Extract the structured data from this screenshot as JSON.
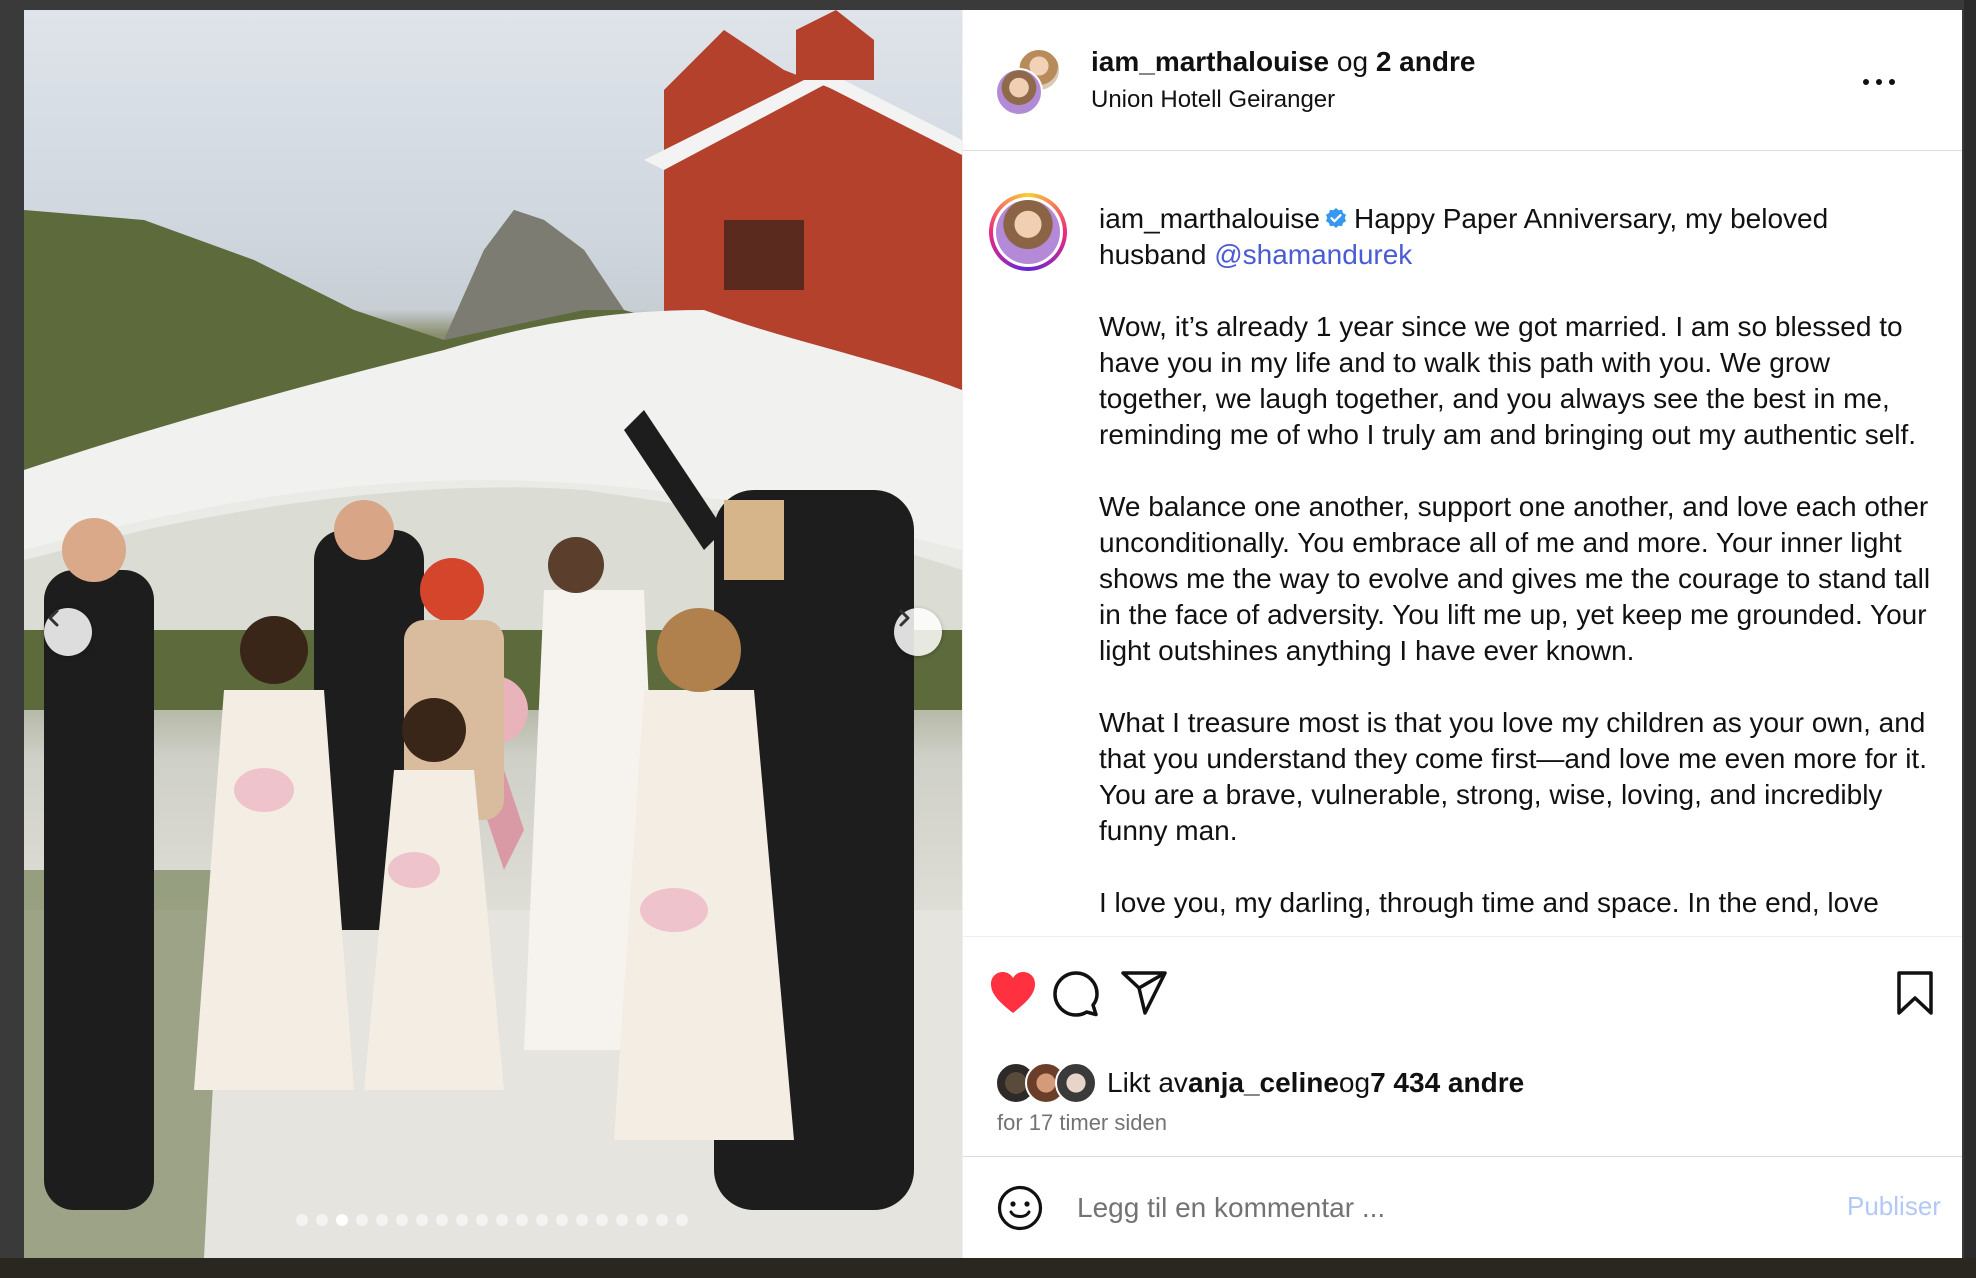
{
  "header": {
    "username": "iam_marthalouise",
    "connector": " og ",
    "others": "2 andre",
    "location": "Union Hotell Geiranger"
  },
  "caption": {
    "username": "iam_marthalouise",
    "first_line": "Happy Paper Anniversary, my beloved husband ",
    "mention": "@shamandurek",
    "paragraphs": [
      "Wow, it’s already 1 year since we got married. I am so blessed to have you in my life and to walk this path with you. We grow together, we laugh together, and you always see the best in me, reminding me of who I truly am and bringing out my authentic self.",
      "We balance one another, support one another, and love each other unconditionally. You embrace all of me and more. Your inner light shows me the way to evolve and gives me the courage to stand tall in the face of adversity. You lift me up, yet keep me grounded. Your light outshines anything I have ever known.",
      "What I treasure most is that you love my children as your own, and that you understand they come first—and love me even more for it. You are a brave, vulnerable, strong, wise, loving, and incredibly funny man.",
      "I love you, my darling, through time and space. In the end, love"
    ]
  },
  "likes": {
    "prefix": "Likt av ",
    "user": "anja_celine",
    "connector": " og ",
    "count": "7 434 andre"
  },
  "time": "for 17 timer siden",
  "comment": {
    "placeholder": "Legg til en kommentar ...",
    "publish": "Publiser"
  },
  "carousel": {
    "total": 20,
    "active_index": 2
  },
  "colors": {
    "like_red": "#ff3040",
    "mention_blue": "#4a5bd4",
    "verified_blue": "#3897f0",
    "publish_disabled": "#b2c8f6"
  },
  "icons": [
    "heart-icon",
    "comment-icon",
    "share-icon",
    "bookmark-icon",
    "emoji-icon",
    "verified-icon",
    "more-icon",
    "chevron-left-icon",
    "chevron-right-icon"
  ]
}
